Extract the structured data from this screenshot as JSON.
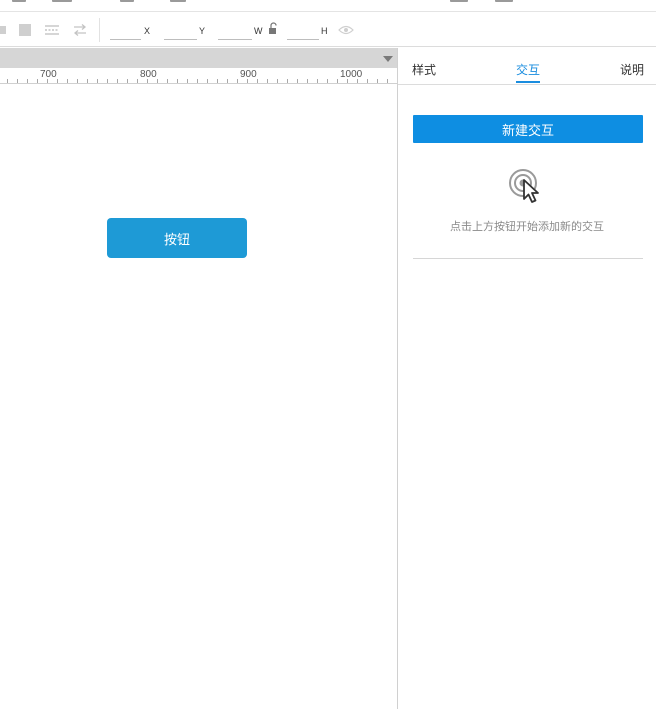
{
  "toolbar": {
    "x_label": "X",
    "y_label": "Y",
    "w_label": "W",
    "h_label": "H"
  },
  "ruler": {
    "marks": [
      "700",
      "800",
      "900",
      "1000"
    ]
  },
  "canvas": {
    "button_label": "按钮",
    "button_color": "#1e9ad6"
  },
  "panel": {
    "tabs": [
      {
        "label": "样式"
      },
      {
        "label": "交互"
      },
      {
        "label": "说明"
      }
    ],
    "active_tab": "交互",
    "accent_color": "#1a8ddf",
    "new_interaction_label": "新建交互",
    "hint": "点击上方按钮开始添加新的交互",
    "empty_state_icon": "cursor-click-icon"
  },
  "icons": {
    "toolbar": [
      "fill-swatch-icon",
      "align-icon",
      "swap-icon",
      "lock-icon",
      "visibility-eye-icon"
    ]
  }
}
